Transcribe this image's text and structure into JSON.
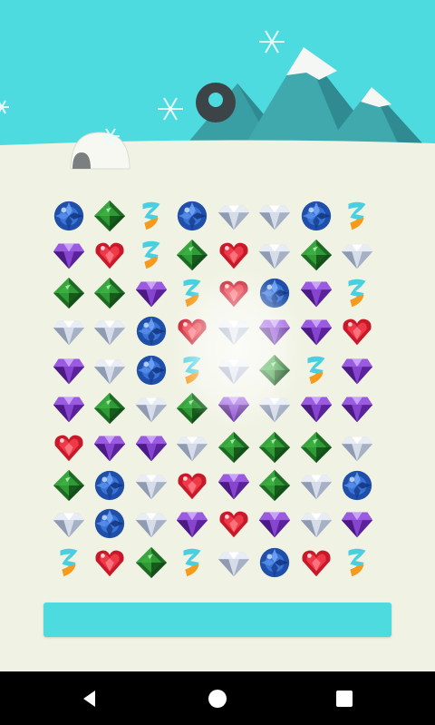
{
  "colors": {
    "sky": "#4ddbe0",
    "ground": "#f0f2e3",
    "progress_bar": "#4ddbe0",
    "nav_bar": "#000000"
  },
  "scene": {
    "elements": [
      "snowflake-icon",
      "mountain-icon",
      "igloo-icon",
      "donut-icon"
    ]
  },
  "gem_types": {
    "B": "blue-sapphire",
    "G": "green-emerald",
    "Z": "cyan-orange-zigzag",
    "D": "white-diamond",
    "P": "purple-amethyst",
    "R": "red-ruby-heart"
  },
  "board": {
    "rows": 10,
    "cols": 8,
    "grid": [
      [
        "B",
        "G",
        "Z",
        "B",
        "D",
        "D",
        "B",
        "Z"
      ],
      [
        "P",
        "R",
        "Z",
        "G",
        "R",
        "D",
        "G",
        "D"
      ],
      [
        "G",
        "G",
        "P",
        "Z",
        "R",
        "B",
        "P",
        "Z"
      ],
      [
        "D",
        "D",
        "B",
        "R",
        "D",
        "P",
        "P",
        "R"
      ],
      [
        "P",
        "D",
        "B",
        "Z",
        "D",
        "G",
        "Z",
        "P"
      ],
      [
        "P",
        "G",
        "D",
        "G",
        "P",
        "D",
        "P",
        "P"
      ],
      [
        "R",
        "P",
        "P",
        "D",
        "G",
        "G",
        "G",
        "D"
      ],
      [
        "G",
        "B",
        "D",
        "R",
        "P",
        "G",
        "D",
        "B"
      ],
      [
        "D",
        "B",
        "D",
        "P",
        "R",
        "P",
        "D",
        "P"
      ],
      [
        "Z",
        "R",
        "G",
        "Z",
        "D",
        "B",
        "R",
        "Z"
      ]
    ]
  },
  "progress": {
    "fraction": 1.0
  },
  "nav": {
    "buttons": [
      "back-icon",
      "home-icon",
      "recents-icon"
    ]
  }
}
